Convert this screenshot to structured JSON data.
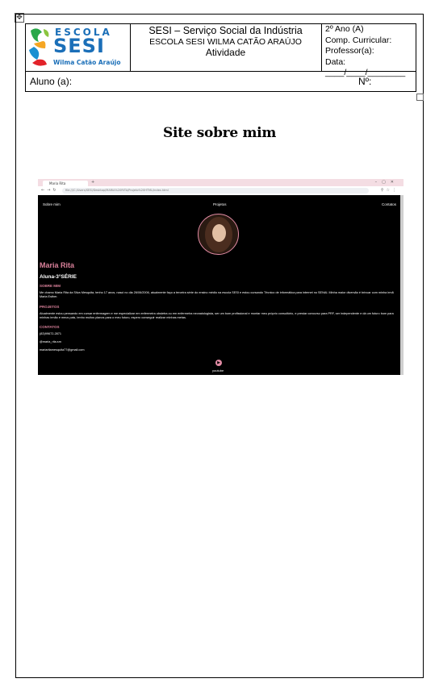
{
  "header": {
    "logo": {
      "line1": "ESCOLA",
      "line2": "SESI",
      "line3": "Wilma Catão Araújo"
    },
    "institution": "SESI – Serviço Social da Indústria",
    "school": "ESCOLA SESI WILMA CATÃO ARAÚJO",
    "doc_type": "Atividade",
    "grade": "2º Ano (A)",
    "component": "Comp. Curricular:",
    "teacher": "Professor(a):",
    "date": "Data: ____/____/________"
  },
  "student": {
    "label": "Aluno (a):",
    "number_label": "Nº:"
  },
  "title": "Site sobre mim",
  "browser": {
    "tab_title": "Maria Rita",
    "url": "file:///C:/Users/SESI/Desktop/MARIA%20RITA/Projeto%20HTML/index.html"
  },
  "site": {
    "nav": [
      "Sobre mim",
      "Projetos",
      "Contatos"
    ],
    "name": "Maria Rita",
    "grade": "Aluna-3°SÉRIE",
    "about_heading": "SOBRE MIM",
    "about_text": "Me chamo Maria Rita da Silva Mesquita, tenho 17 anos, nasci no dia 26/06/2006, atualmente faço a terceira série do ensino médio na escola SESI e estou cursando Técnico de informática para internet no SENAI. Minha maior diversão é brincar com minha irmã Maria Esther.",
    "projects_heading": "PROJETOS",
    "projects_text": "Atualmente estou pensando em cursar enfermagem e me especializar em enfermeira obstetra ou em enfermeira neonatologista, ser um bom profissional e montar meu próprio consultório, e prestar concurso para PRF, ser independente e dá um futuro bom para minhas irmão e meus pais, tenho muitos planos para o meu futuro, espero conseguir realizar minhas metas.",
    "contacts_heading": "CONTATOS",
    "contacts": [
      "(83)99672-2871",
      "@maria_rita.sm",
      "mariaritamesquita77@gmail.com"
    ],
    "youtube_label": "youtube"
  }
}
